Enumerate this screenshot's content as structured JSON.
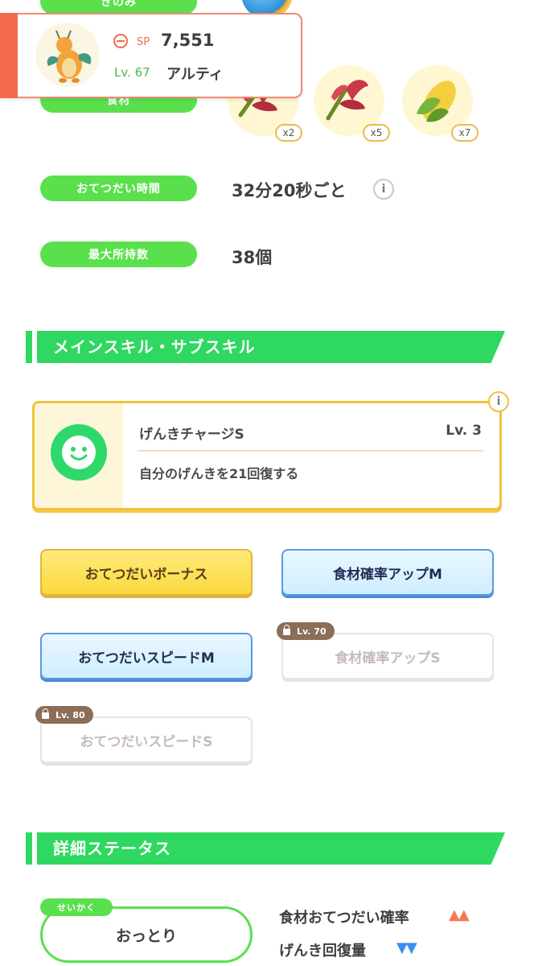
{
  "top": {
    "berry_label": "きのみ",
    "ingredient_label": "食材",
    "ingredients": [
      {
        "name": "red-leaf-icon",
        "count": "x2"
      },
      {
        "name": "red-leaf-icon",
        "count": "x5"
      },
      {
        "name": "corn-icon",
        "count": "x7"
      }
    ]
  },
  "popup": {
    "sp_label": "SP",
    "sp_value": "7,551",
    "level": "Lv. 67",
    "nickname": "アルティ",
    "accent_color": "#f26b4c"
  },
  "stats": {
    "help_time_label": "おてつだい時間",
    "help_time_value": "32分20秒ごと",
    "max_carry_label": "最大所持数",
    "max_carry_value": "38個"
  },
  "skills_section": {
    "title": "メインスキル・サブスキル",
    "main_skill_name": "げんきチャージS",
    "main_skill_level": "Lv. 3",
    "main_skill_desc": "自分のげんきを21回復する",
    "sub_skills": [
      {
        "label": "おてつだいボーナス",
        "style": "gold",
        "locked": false
      },
      {
        "label": "食材確率アップM",
        "style": "blue",
        "locked": false
      },
      {
        "label": "おてつだいスピードM",
        "style": "blue",
        "locked": false
      },
      {
        "label": "食材確率アップS",
        "style": "locked",
        "locked": true,
        "unlock": "Lv. 70"
      },
      {
        "label": "おてつだいスピードS",
        "style": "locked",
        "locked": true,
        "unlock": "Lv. 80"
      }
    ]
  },
  "details_section": {
    "title": "詳細ステータス",
    "nature_tag": "せいかく",
    "nature_value": "おっとり",
    "up_stat": "食材おてつだい確率",
    "up_marks": "▲▲",
    "down_stat": "げんき回復量",
    "down_marks": "▼▼"
  },
  "colors": {
    "green": "#5be04d",
    "section_green": "#2fd860",
    "up_orange": "#f47b4f",
    "down_blue": "#3b8ef0"
  }
}
